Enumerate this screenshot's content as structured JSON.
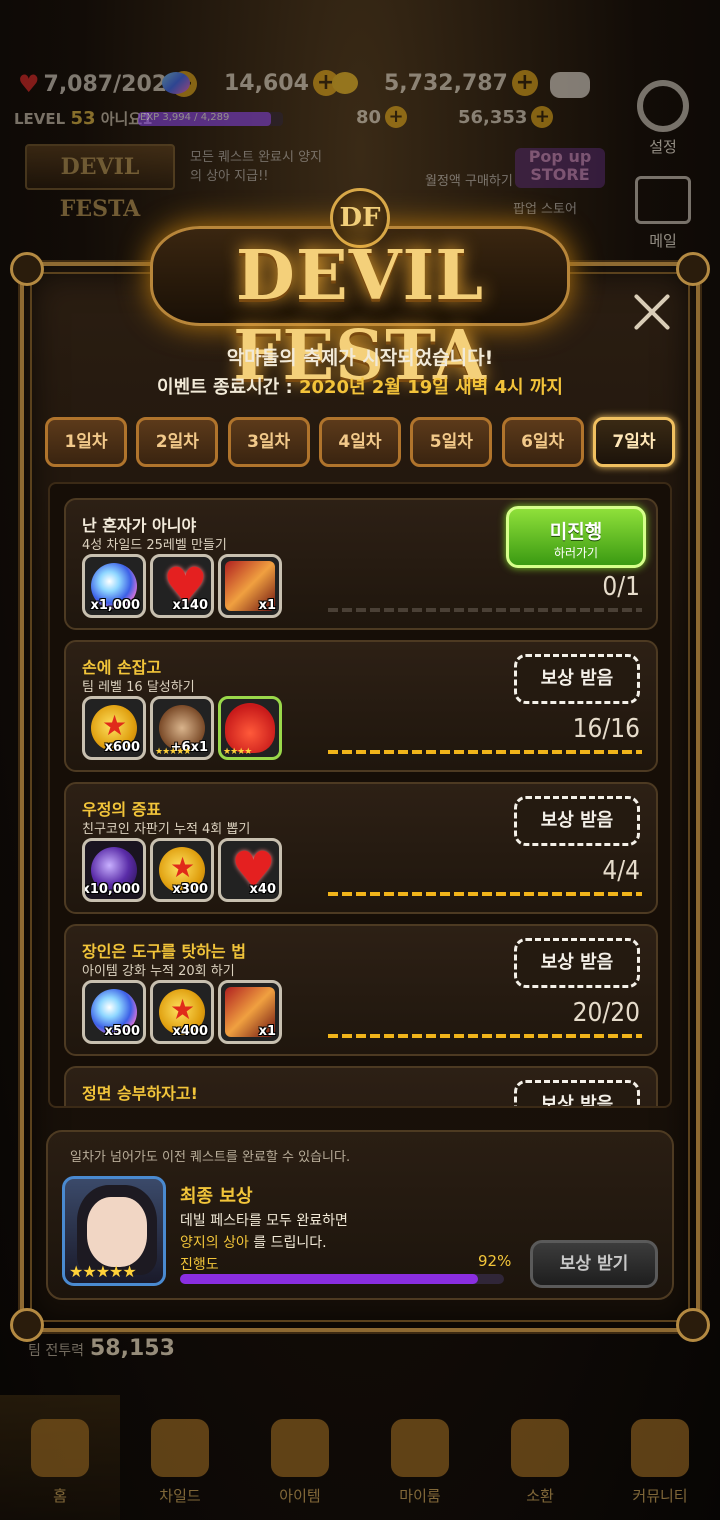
{
  "topbar": {
    "hearts": "7,087/202",
    "gems": "14,604",
    "gold": "5,732,787",
    "level_label": "LEVEL",
    "level": "53",
    "player_name": "아니요1",
    "exp": "EXP 3,994 / 4,289",
    "stamina": "80",
    "dark": "56,353"
  },
  "side": {
    "settings": "설정",
    "mail": "메일"
  },
  "banners": {
    "devil_festa": "DEVIL FESTA",
    "quest_note": "모든 퀘스트 완료시 양지의 상아 지급!!",
    "monthly": "월정액 구매하기",
    "popup": "Pop up STORE",
    "popup_label": "팝업 스토어"
  },
  "modal": {
    "logo_emblem": "DF",
    "logo": "DEVIL FESTA",
    "subtitle": "악마들의 축제가 시작되었습니다!",
    "end_time_label": "이벤트 종료시간 : ",
    "end_time_value": "2020년 2월 19일 새벽 4시 까지",
    "tabs": [
      "1일차",
      "2일차",
      "3일차",
      "4일차",
      "5일차",
      "6일차",
      "7일차"
    ],
    "active_tab": 6,
    "quests": [
      {
        "title": "난 혼자가 아니야",
        "desc": "4성 차일드 25레벨 만들기",
        "items": [
          {
            "icon": "gem",
            "qty": "x1,000"
          },
          {
            "icon": "heart",
            "qty": "x140"
          },
          {
            "icon": "ticket",
            "qty": "x1"
          }
        ],
        "progress": "0/1",
        "button_main": "미진행",
        "button_sub": "하러가기"
      },
      {
        "title": "손에 손잡고",
        "desc": "팀 레벨 16 달성하기",
        "items": [
          {
            "icon": "medal",
            "qty": "x600"
          },
          {
            "icon": "enhance",
            "qty": "+6x1"
          },
          {
            "icon": "slime",
            "qty": ""
          }
        ],
        "progress": "16/16",
        "button": "보상 받음"
      },
      {
        "title": "우정의 증표",
        "desc": "친구코인 자판기 누적 4회 뽑기",
        "items": [
          {
            "icon": "dark-gem",
            "qty": "x10,000"
          },
          {
            "icon": "medal",
            "qty": "x300"
          },
          {
            "icon": "heart",
            "qty": "x40"
          }
        ],
        "progress": "4/4",
        "button": "보상 받음"
      },
      {
        "title": "장인은 도구를 탓하는 법",
        "desc": "아이템 강화 누적 20회 하기",
        "items": [
          {
            "icon": "gem",
            "qty": "x500"
          },
          {
            "icon": "medal",
            "qty": "x400"
          },
          {
            "icon": "ticket",
            "qty": "x1"
          }
        ],
        "progress": "20/20",
        "button": "보상 받음"
      },
      {
        "title": "정면 승부하자고!",
        "desc": "",
        "items": [],
        "progress": "",
        "button": "보상 받음"
      }
    ],
    "final": {
      "note": "일차가 넘어가도 이전 퀘스트를 완료할 수 있습니다.",
      "title": "최종 보상",
      "line1": "데빌 페스타를 모두 완료하면",
      "line2_hl": "양지의 상아",
      "line2_rest": " 를 드립니다.",
      "progress_label": "진행도",
      "progress_pct": "92%",
      "progress_value": 0.92,
      "button": "보상 받기"
    }
  },
  "team_power": {
    "label": "팀 전투력",
    "value": "58,153"
  },
  "nav": [
    "홈",
    "차일드",
    "아이템",
    "마이룸",
    "소환",
    "커뮤니티"
  ],
  "colors": {
    "accent_gold": "#f2c53a",
    "progress_purple": "#8a2ee0",
    "go_button_green": "#5cc21e"
  }
}
